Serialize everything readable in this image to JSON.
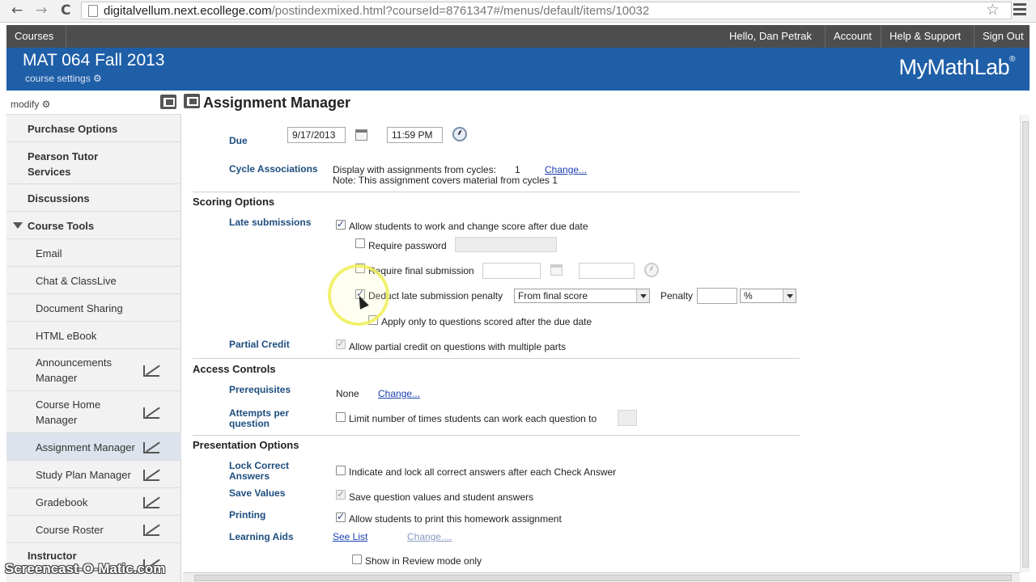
{
  "browser": {
    "back": "←",
    "forward": "→",
    "reload": "C",
    "url_host": "digitalvellum.next.ecollege.com",
    "url_path": "/postindexmixed.html?courseId=8761347#/menus/default/items/10032",
    "star": "☆"
  },
  "topnav": {
    "courses": "Courses",
    "greeting": "Hello, Dan Petrak",
    "account": "Account",
    "help": "Help & Support",
    "signout": "Sign Out"
  },
  "header": {
    "course_title": "MAT 064 Fall 2013",
    "course_settings": "course settings ⚙",
    "logo": "MyMathLab",
    "logo_mark": "®"
  },
  "sidebar": {
    "modify": "modify ⚙",
    "items": [
      {
        "label": "Purchase Options"
      },
      {
        "label": "Pearson Tutor Services"
      },
      {
        "label": "Discussions"
      },
      {
        "label": "Course Tools"
      },
      {
        "label": "Email"
      },
      {
        "label": "Chat & ClassLive"
      },
      {
        "label": "Document Sharing"
      },
      {
        "label": "HTML eBook"
      },
      {
        "label": "Announcements Manager"
      },
      {
        "label": "Course Home Manager"
      },
      {
        "label": "Assignment Manager"
      },
      {
        "label": "Study Plan Manager"
      },
      {
        "label": "Gradebook"
      },
      {
        "label": "Course Roster"
      },
      {
        "label": "Instructor"
      }
    ]
  },
  "main": {
    "title": "Assignment Manager",
    "due": {
      "label": "Due",
      "date": "9/17/2013",
      "time": "11:59 PM"
    },
    "cycle": {
      "label": "Cycle Associations",
      "line1": "Display with assignments from cycles:",
      "count": "1",
      "change": "Change...",
      "note": "Note: This assignment covers material from cycles 1"
    },
    "scoring": {
      "heading": "Scoring Options",
      "late_label": "Late submissions",
      "allow_change": "Allow students to work and change score after due date",
      "require_password": "Require password",
      "require_final": "Require final submission",
      "deduct": "Deduct late submission penalty",
      "deduct_mode": "From final score",
      "penalty_label": "Penalty",
      "penalty_unit": "%",
      "apply_only": "Apply only to questions scored after the due date",
      "partial_label": "Partial Credit",
      "partial_text": "Allow partial credit on questions with multiple parts"
    },
    "access": {
      "heading": "Access Controls",
      "prereq_label": "Prerequisites",
      "prereq_value": "None",
      "prereq_change": "Change...",
      "attempts_label_1": "Attempts per",
      "attempts_label_2": "question",
      "attempts_text": "Limit number of times students can work each question to"
    },
    "presentation": {
      "heading": "Presentation Options",
      "lock_label_1": "Lock Correct",
      "lock_label_2": "Answers",
      "lock_text": "Indicate and lock all correct answers after each Check Answer",
      "save_label": "Save Values",
      "save_text": "Save question values and student answers",
      "print_label": "Printing",
      "print_text": "Allow students to print this homework assignment",
      "aids_label": "Learning Aids",
      "aids_see": "See List",
      "aids_change": "Change....",
      "review_text": "Show in Review mode only"
    }
  },
  "watermark": "Screencast-O-Matic.com"
}
